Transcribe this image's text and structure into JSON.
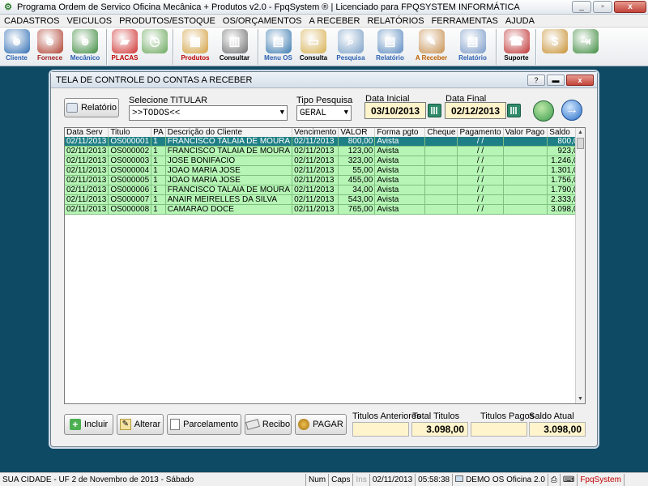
{
  "window": {
    "title": "Programa Ordem de Servico Oficina Mecânica + Produtos v2.0 - FpqSystem ®  | Licenciado para  FPQSYSTEM INFORMÁTICA",
    "min": "_",
    "max": "▫",
    "close": "x"
  },
  "menu": [
    "CADASTROS",
    "VEICULOS",
    "PRODUTOS/ESTOQUE",
    "OS/ORÇAMENTOS",
    "A RECEBER",
    "RELATÓRIOS",
    "FERRAMENTAS",
    "AJUDA"
  ],
  "toolbar": [
    {
      "label": "Cliente",
      "icon": "person-icon",
      "color": "#2e6db4",
      "labelColor": "#2a5fb0"
    },
    {
      "label": "Fornece",
      "icon": "person-icon",
      "color": "#b04030",
      "labelColor": "#a02020"
    },
    {
      "label": "Mecânico",
      "icon": "person-icon",
      "color": "#3c8a3c",
      "labelColor": "#2a5fb0"
    },
    {
      "label": "PLACAS",
      "icon": "car-icon",
      "color": "#d03030",
      "labelColor": "#c00000"
    },
    {
      "label": "",
      "icon": "clock-icon",
      "color": "#6aa85a",
      "labelColor": "#000"
    },
    {
      "label": "Produtos",
      "icon": "boxes-icon",
      "color": "#d4a040",
      "labelColor": "#c00000"
    },
    {
      "label": "Consultar",
      "icon": "barcode-icon",
      "color": "#707070",
      "labelColor": "#000"
    },
    {
      "label": "Menu OS",
      "icon": "clipboard-icon",
      "color": "#3a7ab0",
      "labelColor": "#2a5fb0"
    },
    {
      "label": "Consulta",
      "icon": "folder-icon",
      "color": "#d8b050",
      "labelColor": "#000"
    },
    {
      "label": "Pesquisa",
      "icon": "magnifier-icon",
      "color": "#7aa0c8",
      "labelColor": "#2a5fb0"
    },
    {
      "label": "Relatório",
      "icon": "report-icon",
      "color": "#5a8ac0",
      "labelColor": "#2a5fb0"
    },
    {
      "label": "A Receber",
      "icon": "receive-icon",
      "color": "#c89050",
      "labelColor": "#c06000"
    },
    {
      "label": "Relatório",
      "icon": "report-icon",
      "color": "#7a9ac8",
      "labelColor": "#2a5fb0"
    },
    {
      "label": "Suporte",
      "icon": "support-icon",
      "color": "#c03030",
      "labelColor": "#000"
    },
    {
      "label": "",
      "icon": "coin-icon",
      "color": "#c89030",
      "labelColor": "#000"
    },
    {
      "label": "",
      "icon": "exit-icon",
      "color": "#3c8a3c",
      "labelColor": "#000"
    }
  ],
  "dialog": {
    "title": "TELA DE CONTROLE DO CONTAS A RECEBER",
    "help": "?",
    "min": "▬",
    "close": "x",
    "report_button": "Relatório",
    "titular_label": "Selecione TITULAR",
    "titular_value": ">>TODOS<<",
    "tipo_label": "Tipo  Pesquisa",
    "tipo_value": "GERAL",
    "data_inicial_label": "Data Inicial",
    "data_inicial": "03/10/2013",
    "data_final_label": "Data Final",
    "data_final": "02/12/2013"
  },
  "grid": {
    "columns": [
      "Data Serv",
      "Titulo",
      "PA",
      "Descrição do Cliente",
      "Vencimento",
      "VALOR",
      "Forma pgto",
      "Cheque",
      "Pagamento",
      "Valor Pago",
      "Saldo"
    ],
    "rows": [
      [
        "02/11/2013",
        "OS000001",
        "1",
        "FRANCISCO TALAIA DE MOURA",
        "02/11/2013",
        "800,00",
        "Avista",
        "",
        "/ /",
        "",
        "800,00"
      ],
      [
        "02/11/2013",
        "OS000002",
        "1",
        "FRANCISCO TALAIA DE MOURA",
        "02/11/2013",
        "123,00",
        "Avista",
        "",
        "/ /",
        "",
        "923,00"
      ],
      [
        "02/11/2013",
        "OS000003",
        "1",
        "JOSE BONIFACIO",
        "02/11/2013",
        "323,00",
        "Avista",
        "",
        "/ /",
        "",
        "1.246,00"
      ],
      [
        "02/11/2013",
        "OS000004",
        "1",
        "JOAO MARIA JOSE",
        "02/11/2013",
        "55,00",
        "Avista",
        "",
        "/ /",
        "",
        "1.301,00"
      ],
      [
        "02/11/2013",
        "OS000005",
        "1",
        "JOAO MARIA JOSE",
        "02/11/2013",
        "455,00",
        "Avista",
        "",
        "/ /",
        "",
        "1.756,00"
      ],
      [
        "02/11/2013",
        "OS000006",
        "1",
        "FRANCISCO TALAIA DE MOURA",
        "02/11/2013",
        "34,00",
        "Avista",
        "",
        "/ /",
        "",
        "1.790,00"
      ],
      [
        "02/11/2013",
        "OS000007",
        "1",
        "ANAIR MEIRELLES DA SILVA",
        "02/11/2013",
        "543,00",
        "Avista",
        "",
        "/ /",
        "",
        "2.333,00"
      ],
      [
        "02/11/2013",
        "OS000008",
        "1",
        "CAMARÃO DOCE",
        "02/11/2013",
        "765,00",
        "Avista",
        "",
        "/ /",
        "",
        "3.098,00"
      ]
    ]
  },
  "actions": {
    "incluir": "Incluir",
    "alterar": "Alterar",
    "parcelamento": "Parcelamento",
    "recibo": "Recibo",
    "pagar": "PAGAR"
  },
  "totals": {
    "anteriores_label": "Titulos Anteriores",
    "anteriores": "",
    "total_label": "Total Titulos",
    "total": "3.098,00",
    "pagos_label": "Titulos Pagos",
    "pagos": "",
    "saldo_label": "Saldo Atual",
    "saldo": "3.098,00"
  },
  "status": {
    "location": "SUA CIDADE - UF  2 de Novembro de 2013 - Sábado",
    "num": "Num",
    "caps": "Caps",
    "ins": "Ins",
    "date": "02/11/2013",
    "time": "05:58:38",
    "demo": "DEMO OS Oficina 2.0",
    "brand": "FpqSystem"
  }
}
